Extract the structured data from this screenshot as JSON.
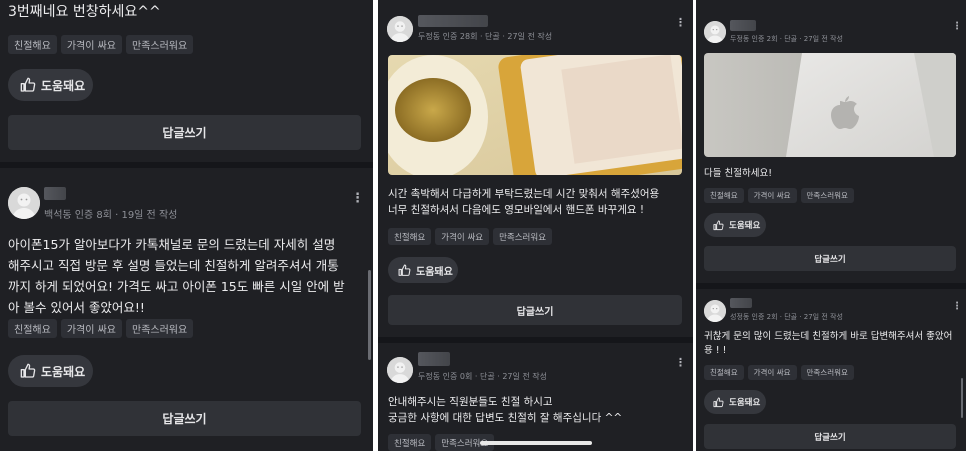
{
  "panel1": {
    "top_text": "3번째네요 번창하세요^^",
    "top_tags": [
      "친절해요",
      "가격이 싸요",
      "만족스러워요"
    ],
    "helpful_label": "도움돼요",
    "reply_label": "답글쓰기",
    "review": {
      "meta": "백석동 인증 8회 · 19일 전 작성",
      "text_lines": [
        "아이폰15가 알아보다가 카톡채널로 문의 드렸는데 자세히 설명",
        "해주시고 직접 방문 후 설명 들었는데 친절하게 알려주셔서 개통",
        "까지 하게 되었어요! 가격도 싸고 아이폰 15도 빠른 시일 안에 받",
        "아 볼수 있어서 좋았어요!!"
      ],
      "tags": [
        "친절해요",
        "가격이 싸요",
        "만족스러워요"
      ],
      "helpful_label": "도움돼요",
      "reply_label": "답글쓰기"
    }
  },
  "panel2": {
    "review1": {
      "meta": "두정동 인증 28회 · 단골 · 27일 전 작성",
      "text_lines": [
        "시간 촉박해서 다급하게 부탁드렸는데 시간 맞춰서 해주셨어용",
        "너무 친절하셔서 다음에도 영모바일에서 핸드폰 바꾸게요 !"
      ],
      "tags": [
        "친절해요",
        "가격이 싸요",
        "만족스러워요"
      ],
      "helpful_label": "도움돼요",
      "reply_label": "답글쓰기"
    },
    "review2": {
      "meta": "두정동 인증 0회 · 단골 · 27일 전 작성",
      "text_lines": [
        "안내해주시는 직원분들도 친절 하시고",
        "궁금한 사항에 대한 답변도 친절히 잘 해주십니다 ^^"
      ],
      "tags": [
        "친절해요",
        "만족스러워요"
      ]
    }
  },
  "panel3": {
    "review1": {
      "meta": "두정동 인증 2회 · 단골 · 27일 전 작성",
      "text": "다들 친절하세요!",
      "tags": [
        "친절해요",
        "가격이 싸요",
        "만족스러워요"
      ],
      "helpful_label": "도움돼요",
      "reply_label": "답글쓰기"
    },
    "review2": {
      "meta": "성정동 인증 2회 · 단골 · 27일 전 작성",
      "text_lines": [
        "귀찮게 문의 많이 드렸는데 친절하게 바로 답변해주셔서 좋았어",
        "용 ! !"
      ],
      "tags": [
        "친절해요",
        "가격이 싸요",
        "만족스러워요"
      ],
      "helpful_label": "도움돼요",
      "reply_label": "답글쓰기"
    }
  },
  "icons": {
    "thumbs_up": "thumbs-up-icon",
    "more": "kebab-menu-icon",
    "avatar": "default-avatar-icon"
  },
  "colors": {
    "background": "#1f2024",
    "chip": "#2e3036",
    "button": "#303237",
    "meta_text": "#8e9097"
  }
}
